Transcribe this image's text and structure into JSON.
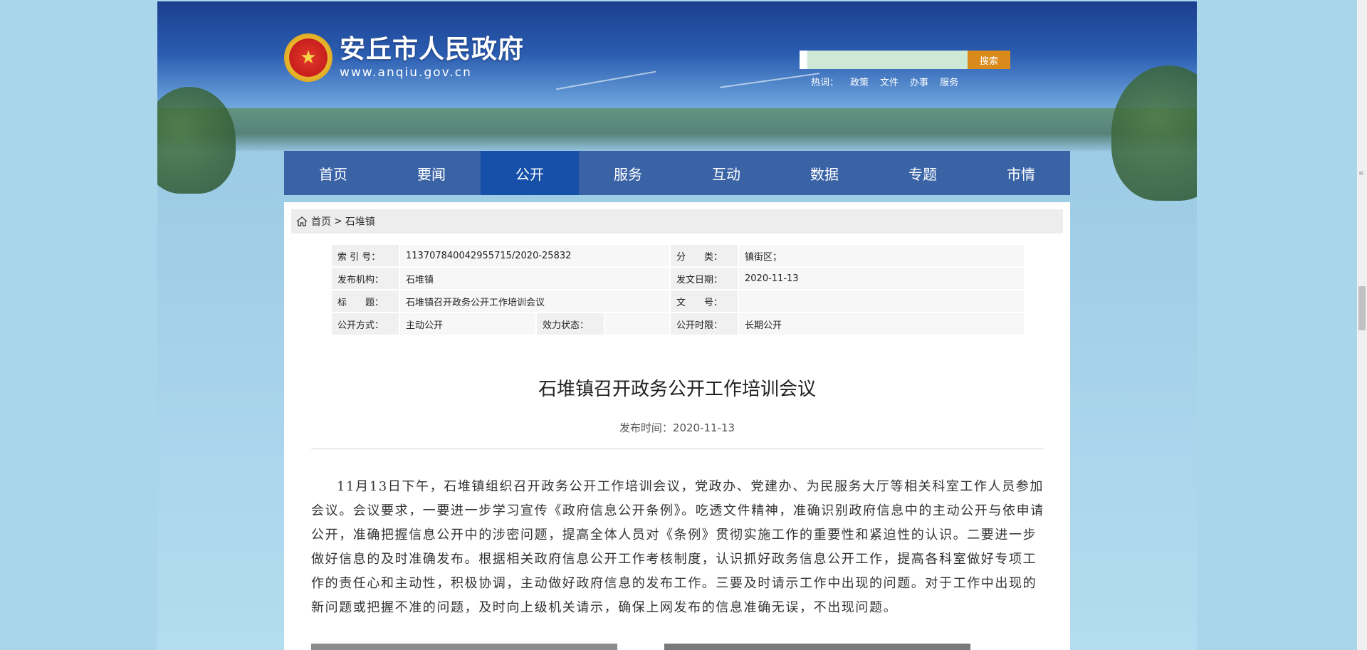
{
  "header": {
    "site_title": "安丘市人民政府",
    "site_url": "www.anqiu.gov.cn",
    "emblem_icon": "national-emblem"
  },
  "search": {
    "placeholder": "",
    "button_label": "搜索",
    "hotwords_label": "热词：",
    "hotwords": [
      "政策",
      "文件",
      "办事",
      "服务"
    ]
  },
  "nav": {
    "items": [
      {
        "label": "首页"
      },
      {
        "label": "要闻"
      },
      {
        "label": "公开"
      },
      {
        "label": "服务"
      },
      {
        "label": "互动"
      },
      {
        "label": "数据"
      },
      {
        "label": "专题"
      },
      {
        "label": "市情"
      }
    ],
    "active": "公开"
  },
  "breadcrumb": {
    "home": "首页",
    "separator": ">",
    "current": "石堆镇"
  },
  "meta": {
    "index_label": "索 引 号：",
    "index_value": "113707840042955715/2020-25832",
    "category_label": "分　　类：",
    "category_value": "镇街区；",
    "publisher_label": "发布机构：",
    "publisher_value": "石堆镇",
    "date_label": "发文日期：",
    "date_value": "2020-11-13",
    "title_label": "标　　题：",
    "title_value": "石堆镇召开政务公开工作培训会议",
    "docno_label": "文　　号：",
    "docno_value": "",
    "mode_label": "公开方式：",
    "mode_value": "主动公开",
    "validity_label": "效力状态：",
    "validity_value": "",
    "period_label": "公开时限：",
    "period_value": "长期公开"
  },
  "article": {
    "title": "石堆镇召开政务公开工作培训会议",
    "publish_time": "发布时间：2020-11-13",
    "body": "11月13日下午，石堆镇组织召开政务公开工作培训会议，党政办、党建办、为民服务大厅等相关科室工作人员参加会议。会议要求，一要进一步学习宣传《政府信息公开条例》。吃透文件精神，准确识别政府信息中的主动公开与依申请公开，准确把握信息公开中的涉密问题，提高全体人员对《条例》贯彻实施工作的重要性和紧迫性的认识。二要进一步做好信息的及时准确发布。根据相关政府信息公开工作考核制度，认识抓好政务信息公开工作，提高各科室做好专项工作的责任心和主动性，积极协调，主动做好政府信息的发布工作。三要及时请示工作中出现的问题。对于工作中出现的新问题或把握不准的问题，及时向上级机关请示，确保上网发布的信息准确无误，不出现问题。"
  },
  "colors": {
    "nav_bg": "#3a63a6",
    "nav_active": "#1650a8",
    "search_button": "#d98a1a",
    "page_bg": "#a9d6ea"
  }
}
